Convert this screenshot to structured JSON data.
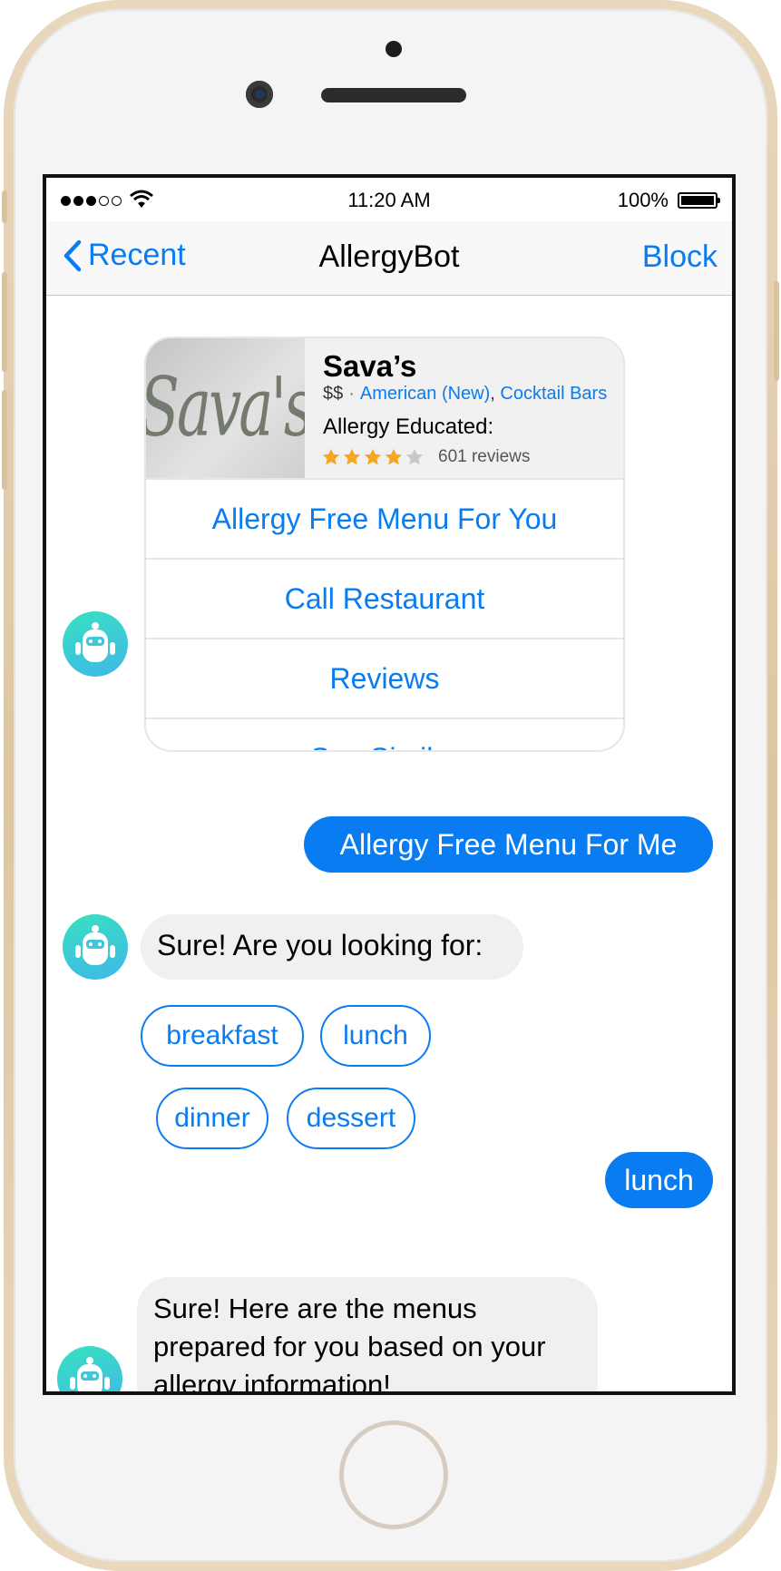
{
  "status_bar": {
    "time": "11:20 AM",
    "battery": "100%"
  },
  "nav": {
    "back_label": "Recent",
    "title": "AllergyBot",
    "right_label": "Block"
  },
  "card": {
    "logo_text": "Sava's",
    "name": "Sava’s",
    "price": "$$",
    "cuisine_1": "American (New)",
    "cuisine_2": "Cocktail Bars",
    "educated_label": "Allergy Educated:",
    "rating": 4,
    "rating_max": 5,
    "reviews": "601 reviews",
    "buttons": [
      "Allergy Free Menu For You",
      "Call Restaurant",
      "Reviews",
      "See Similar"
    ]
  },
  "messages": {
    "user_1": "Allergy Free Menu For Me",
    "bot_1": "Sure! Are you looking for:",
    "quick_replies": [
      "breakfast",
      "lunch",
      "dinner",
      "dessert"
    ],
    "user_2": "lunch",
    "bot_2": "Sure! Here are the menus prepared for you based on your allergy information!"
  },
  "avatar_label": "AllergyBot",
  "colors": {
    "accent": "#0a7cf1",
    "bubble_in": "#f0f0f0",
    "star": "#f5a623"
  }
}
